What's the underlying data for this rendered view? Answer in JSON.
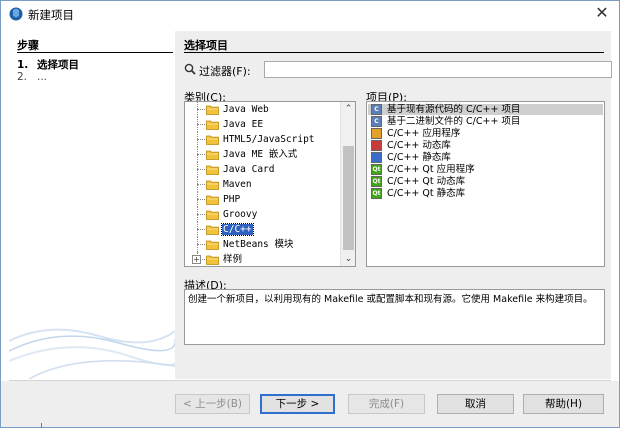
{
  "window": {
    "title": "新建项目"
  },
  "steps": {
    "heading": "步骤",
    "items": [
      {
        "num": "1.",
        "label": "选择项目"
      },
      {
        "num": "2.",
        "label": "..."
      }
    ]
  },
  "main": {
    "heading": "选择项目",
    "filter": {
      "label": "过滤器(F):",
      "value": ""
    },
    "categories": {
      "label": "类别(C):",
      "items": [
        "Java Web",
        "Java EE",
        "HTML5/JavaScript",
        "Java ME 嵌入式",
        "Java Card",
        "Maven",
        "PHP",
        "Groovy",
        "C/C++",
        "NetBeans 模块",
        "样例"
      ],
      "selected": "C/C++"
    },
    "projects": {
      "label": "项目(P):",
      "items": [
        {
          "label": "基于现有源代码的 C/C++ 项目",
          "icon": "cpp-source-icon"
        },
        {
          "label": "基于二进制文件的 C/C++ 项目",
          "icon": "cpp-binary-icon"
        },
        {
          "label": "C/C++ 应用程序",
          "icon": "cpp-app-icon"
        },
        {
          "label": "C/C++ 动态库",
          "icon": "cpp-dynamic-lib-icon"
        },
        {
          "label": "C/C++ 静态库",
          "icon": "cpp-static-lib-icon"
        },
        {
          "label": "C/C++ Qt 应用程序",
          "icon": "qt-app-icon"
        },
        {
          "label": "C/C++ Qt 动态库",
          "icon": "qt-dynamic-lib-icon"
        },
        {
          "label": "C/C++ Qt 静态库",
          "icon": "qt-static-lib-icon"
        }
      ],
      "selected": "基于现有源代码的 C/C++ 项目"
    },
    "description": {
      "label": "描述(D):",
      "text": "创建一个新项目，以利用现有的 Makefile 或配置脚本和现有源。它使用 Makefile 来构建项目。"
    }
  },
  "buttons": {
    "prev": "< 上一步(B)",
    "next": "下一步 >",
    "finish": "完成(F)",
    "cancel": "取消",
    "help": "帮助(H)"
  },
  "colors": {
    "selection": "#2f62c0",
    "panel": "#eeeeee",
    "folder": "#f2c23a"
  }
}
